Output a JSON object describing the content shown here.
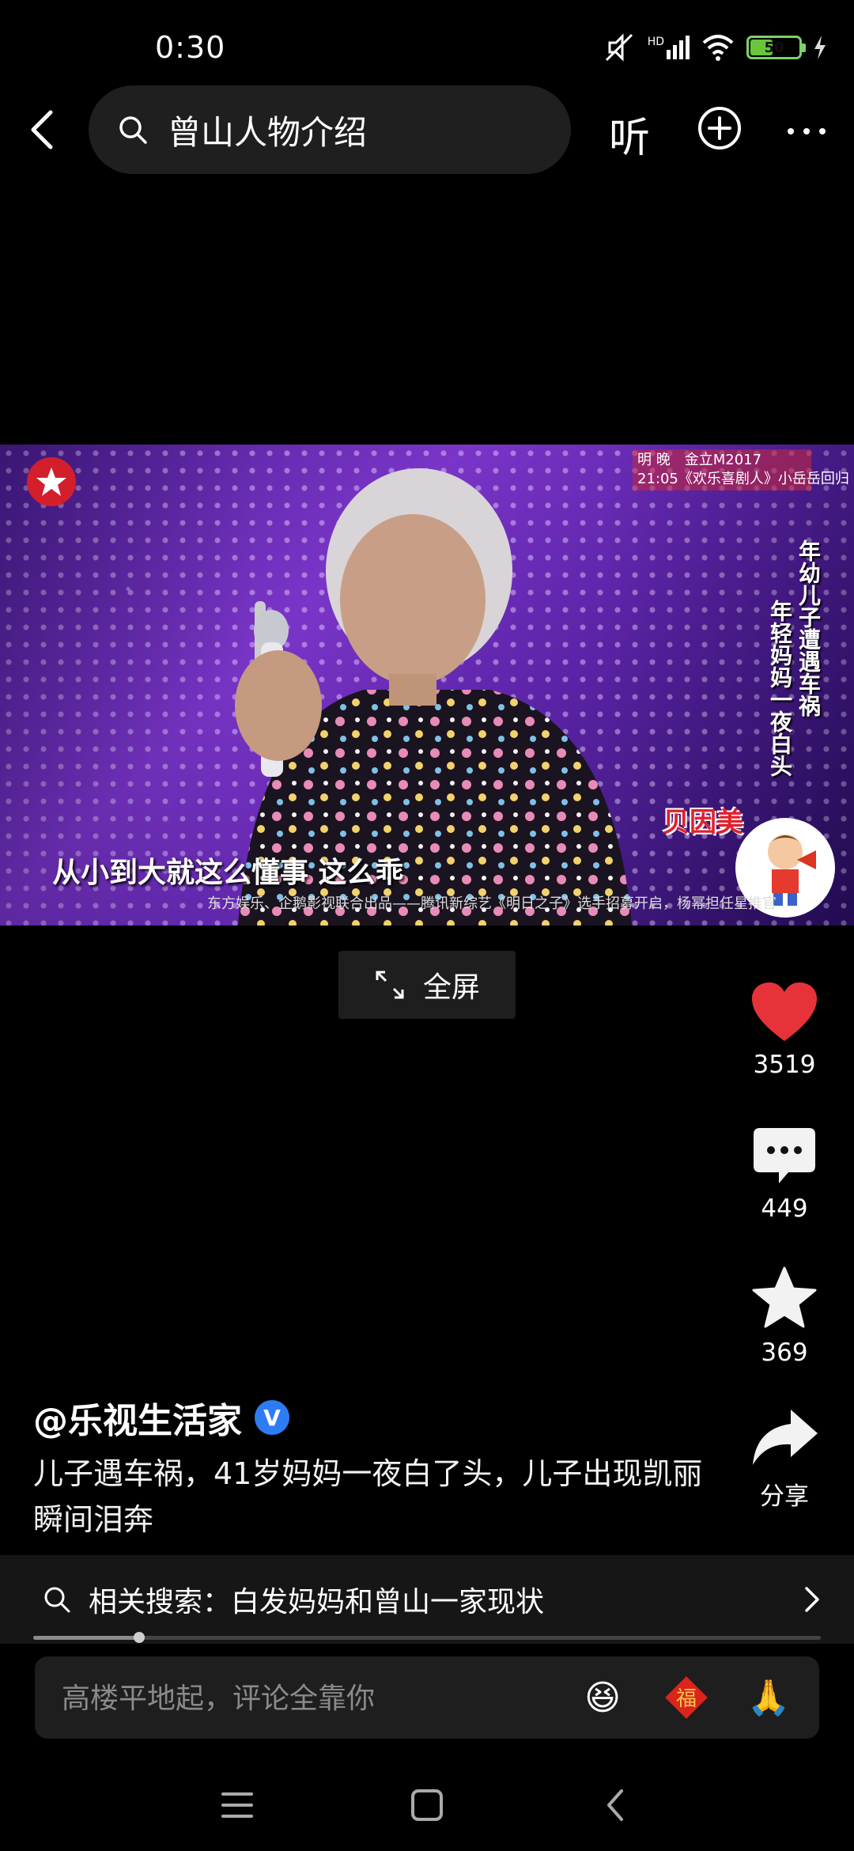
{
  "status_bar": {
    "time": "0:30",
    "network": "HD",
    "battery": "50",
    "battery_level": 0.5
  },
  "top_bar": {
    "back_icon": "back-arrow-icon",
    "search_query": "曾山人物介绍",
    "listen_label": "听",
    "add_icon": "plus-circle-icon",
    "more_icon": "more-dots-icon"
  },
  "video": {
    "promo_line1": "明 晚　金立M2017",
    "promo_line2": "21:05《欢乐喜剧人》小岳岳回归",
    "side_caption_1": "年幼儿子遭遇车祸",
    "side_caption_2": "年轻妈妈一夜白头",
    "sponsor": "贝因美",
    "subtitle": "从小到大就这么懂事 这么乖",
    "credit": "东方娱乐、企鹅影视联合出品——腾讯新综艺《明日之子》选手招募开启，杨幂担任星推官"
  },
  "fullscreen": {
    "label": "全屏"
  },
  "actions": {
    "like_count": "3519",
    "comment_count": "449",
    "favorite_count": "369",
    "share_label": "分享"
  },
  "post": {
    "author": "@乐视生活家",
    "verified_badge": "V",
    "description": "儿子遇车祸，41岁妈妈一夜白了头，儿子出现凯丽瞬间泪奔"
  },
  "related_search": {
    "text": "相关搜索：白发妈妈和曾山一家现状"
  },
  "playback": {
    "progress": 0.135
  },
  "comment_box": {
    "placeholder": "高楼平地起，评论全靠你",
    "emoji_1": "😆",
    "emoji_2": "福",
    "emoji_3": "🙏"
  },
  "colors": {
    "like": "#e8323a",
    "background": "#000000",
    "verified": "#2d7cf6"
  }
}
